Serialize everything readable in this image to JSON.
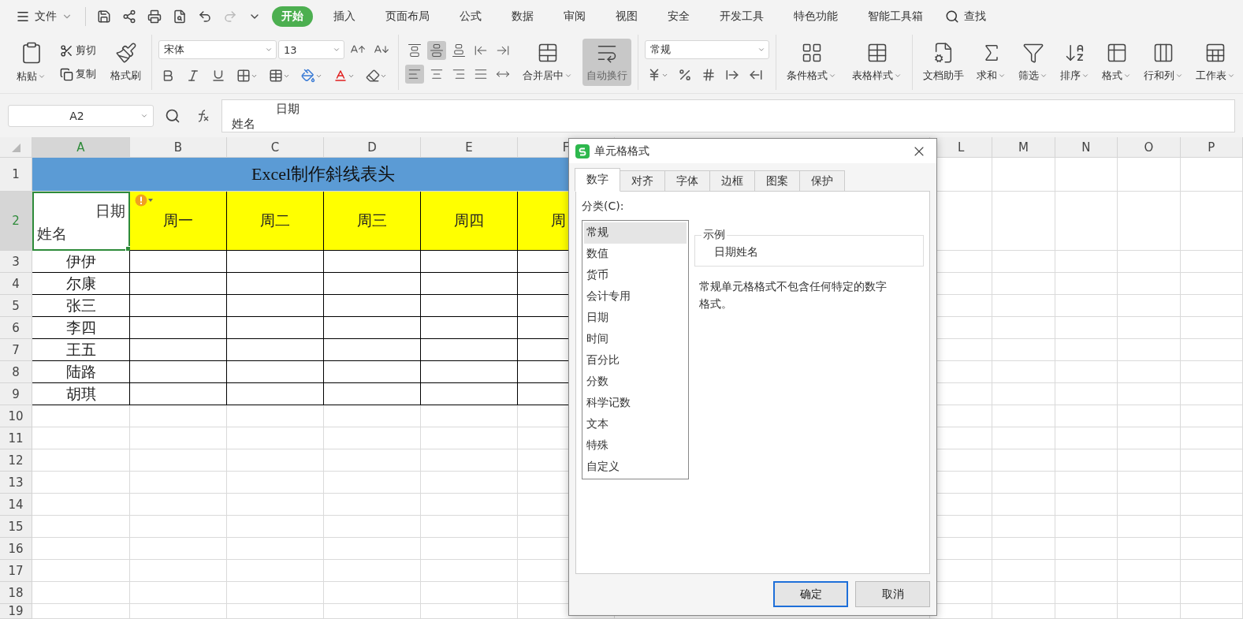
{
  "menu": {
    "file": "文件",
    "tabs": [
      {
        "label": "开始",
        "selected": true
      },
      {
        "label": "插入",
        "selected": false
      },
      {
        "label": "页面布局",
        "selected": false
      },
      {
        "label": "公式",
        "selected": false
      },
      {
        "label": "数据",
        "selected": false
      },
      {
        "label": "审阅",
        "selected": false
      },
      {
        "label": "视图",
        "selected": false
      },
      {
        "label": "安全",
        "selected": false
      },
      {
        "label": "开发工具",
        "selected": false
      },
      {
        "label": "特色功能",
        "selected": false
      },
      {
        "label": "智能工具箱",
        "selected": false
      }
    ],
    "search": "查找"
  },
  "ribbon": {
    "clipboard": {
      "paste": "粘贴",
      "cut": "剪切",
      "copy": "复制",
      "format_painter": "格式刷"
    },
    "font": {
      "name": "宋体",
      "size": "13"
    },
    "alignment": {
      "buttons": [
        {
          "selected": false
        },
        {
          "selected": true
        },
        {
          "selected": false
        },
        {
          "selected": false
        },
        {
          "selected": false
        },
        {
          "selected": true
        },
        {
          "selected": false
        },
        {
          "selected": false
        },
        {
          "selected": false
        },
        {
          "selected": false
        }
      ],
      "merge": {
        "label": "合并居中",
        "menu": true,
        "selected": false
      },
      "wrap": {
        "label": "自动换行",
        "menu": false,
        "selected": true
      }
    },
    "number": {
      "format": "常规"
    },
    "styles": [
      {
        "label": "条件格式",
        "menu": true
      },
      {
        "label": "表格样式",
        "menu": true
      }
    ],
    "tools": [
      {
        "label": "文档助手",
        "menu": false
      },
      {
        "label": "求和",
        "menu": true
      },
      {
        "label": "筛选",
        "menu": true
      },
      {
        "label": "排序",
        "menu": true
      },
      {
        "label": "格式",
        "menu": true
      },
      {
        "label": "行和列",
        "menu": true
      },
      {
        "label": "工作表",
        "menu": true
      }
    ]
  },
  "formula_bar": {
    "name_box": "A2",
    "lines": [
      "日期",
      "姓名"
    ]
  },
  "sheet": {
    "columns": [
      {
        "label": "A",
        "selected": true
      },
      {
        "label": "B",
        "selected": false
      },
      {
        "label": "C",
        "selected": false
      },
      {
        "label": "D",
        "selected": false
      },
      {
        "label": "E",
        "selected": false
      },
      {
        "label": "F",
        "selected": false
      }
    ],
    "right_columns": [
      "L",
      "M",
      "N",
      "O",
      "P"
    ],
    "rows": [
      {
        "label": "1",
        "selected": false
      },
      {
        "label": "2",
        "selected": true
      },
      {
        "label": "3",
        "selected": false
      },
      {
        "label": "4",
        "selected": false
      },
      {
        "label": "5",
        "selected": false
      },
      {
        "label": "6",
        "selected": false
      },
      {
        "label": "7",
        "selected": false
      },
      {
        "label": "8",
        "selected": false
      },
      {
        "label": "9",
        "selected": false
      },
      {
        "label": "10",
        "selected": false
      },
      {
        "label": "11",
        "selected": false
      },
      {
        "label": "12",
        "selected": false
      },
      {
        "label": "13",
        "selected": false
      },
      {
        "label": "14",
        "selected": false
      },
      {
        "label": "15",
        "selected": false
      },
      {
        "label": "16",
        "selected": false
      },
      {
        "label": "17",
        "selected": false
      },
      {
        "label": "18",
        "selected": false
      },
      {
        "label": "19",
        "selected": false
      }
    ],
    "title": "Excel制作斜线表头",
    "header_cell": {
      "top": "日期",
      "bottom": "姓名"
    },
    "days": [
      "周一",
      "周二",
      "周三",
      "周四",
      "周"
    ],
    "names": [
      "伊伊",
      "尔康",
      "张三",
      "李四",
      "王五",
      "陆路",
      "胡琪"
    ]
  },
  "dialog": {
    "title": "单元格格式",
    "tabs": [
      {
        "label": "数字",
        "selected": true
      },
      {
        "label": "对齐",
        "selected": false
      },
      {
        "label": "字体",
        "selected": false
      },
      {
        "label": "边框",
        "selected": false
      },
      {
        "label": "图案",
        "selected": false
      },
      {
        "label": "保护",
        "selected": false
      }
    ],
    "category_label": "分类(C):",
    "categories": [
      {
        "label": "常规",
        "selected": true
      },
      {
        "label": "数值",
        "selected": false
      },
      {
        "label": "货币",
        "selected": false
      },
      {
        "label": "会计专用",
        "selected": false
      },
      {
        "label": "日期",
        "selected": false
      },
      {
        "label": "时间",
        "selected": false
      },
      {
        "label": "百分比",
        "selected": false
      },
      {
        "label": "分数",
        "selected": false
      },
      {
        "label": "科学记数",
        "selected": false
      },
      {
        "label": "文本",
        "selected": false
      },
      {
        "label": "特殊",
        "selected": false
      },
      {
        "label": "自定义",
        "selected": false
      }
    ],
    "sample_label": "示例",
    "sample": "日期姓名",
    "description": "常规单元格格式不包含任何特定的数字格式。",
    "ok": "确定",
    "cancel": "取消"
  }
}
